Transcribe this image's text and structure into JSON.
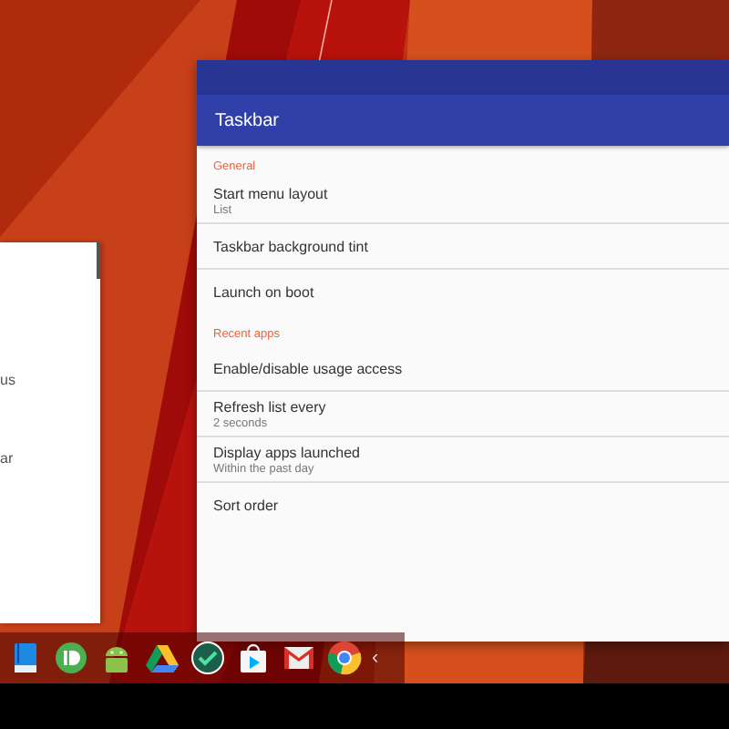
{
  "left_window": {
    "fragments": [
      "us",
      "ar"
    ]
  },
  "settings": {
    "title": "Taskbar",
    "sections": [
      {
        "header": "General",
        "items": [
          {
            "title": "Start menu layout",
            "summary": "List"
          },
          {
            "title": "Taskbar background tint"
          },
          {
            "title": "Launch on boot"
          }
        ]
      },
      {
        "header": "Recent apps",
        "items": [
          {
            "title": "Enable/disable usage access"
          },
          {
            "title": "Refresh list every",
            "summary": "2 seconds"
          },
          {
            "title": "Display apps launched",
            "summary": "Within the past day"
          },
          {
            "title": "Sort order"
          }
        ]
      }
    ]
  },
  "taskbar": {
    "icons": [
      {
        "kind": "notebook"
      },
      {
        "kind": "bullet"
      },
      {
        "kind": "robot"
      },
      {
        "kind": "triangle"
      },
      {
        "kind": "check"
      },
      {
        "kind": "bag"
      },
      {
        "kind": "envelope"
      },
      {
        "kind": "ring"
      }
    ],
    "expand_button": "‹"
  }
}
